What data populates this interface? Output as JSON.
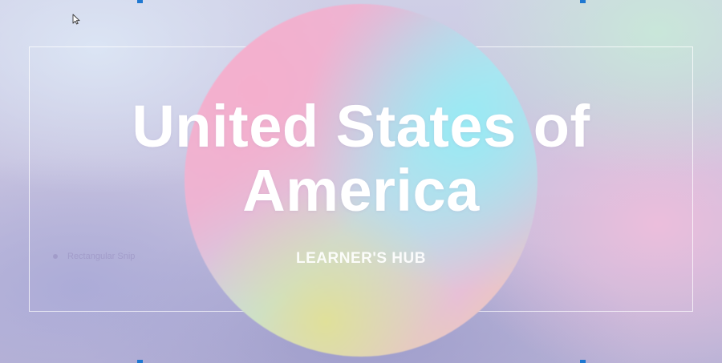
{
  "slide": {
    "title_line1": "United States of",
    "title_line2": "America",
    "subtitle": "LEARNER'S HUB",
    "ghost_label": "Rectangular Snip"
  },
  "icons": {
    "cursor": "mouse-pointer-icon",
    "bullet": "dot-icon"
  },
  "colors": {
    "handle": "#1f78d1",
    "title_text": "#ffffff",
    "frame": "#ffffff"
  }
}
